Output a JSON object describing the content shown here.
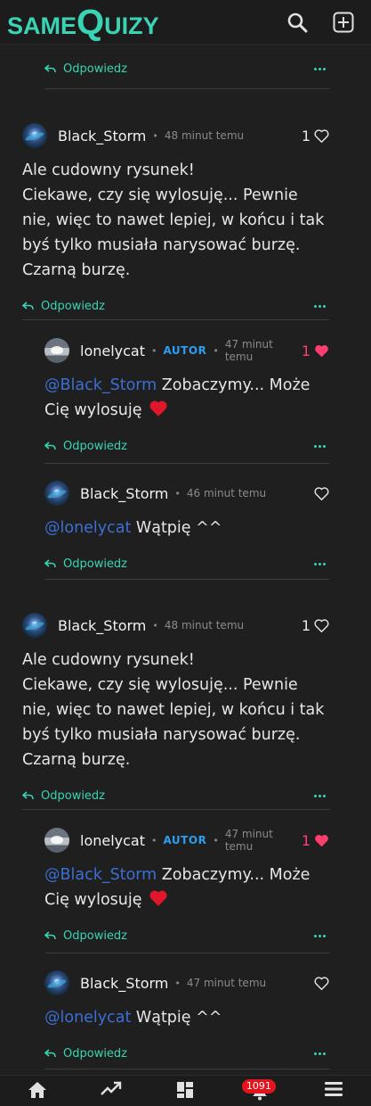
{
  "header": {
    "logo_part1": "SAME",
    "logo_part2": "Q",
    "logo_part3": "UIZY",
    "search_icon": "search-icon",
    "add_icon": "add-square-icon"
  },
  "colors": {
    "accent": "#3ad3b4",
    "mention": "#3b6fd6",
    "author_badge": "#2c9ef0",
    "liked": "#ff3d6e",
    "notif": "#e5131d"
  },
  "top_partial": {
    "reply_label": "Odpowiedz"
  },
  "threads": [
    {
      "comment": {
        "author": "Black_Storm",
        "time": "48 minut temu",
        "likes": "1",
        "text": "Ale cudowny rysunek!\nCiekawe, czy się wylosuję... Pewnie nie, więc to nawet lepiej, w końcu i tak byś tylko musiała narysować burzę. Czarną burzę.",
        "reply_label": "Odpowiedz"
      },
      "replies": [
        {
          "author": "lonelycat",
          "badge": "AUTOR",
          "time": "47 minut temu",
          "likes": "1",
          "mention": "@Black_Storm",
          "text": " Zobaczymy... Może Cię wylosuję ",
          "reply_label": "Odpowiedz"
        },
        {
          "author": "Black_Storm",
          "time": "46 minut temu",
          "likes": "",
          "mention": "@lonelycat",
          "text": " Wątpię ^^",
          "reply_label": "Odpowiedz"
        }
      ]
    },
    {
      "comment": {
        "author": "Black_Storm",
        "time": "48 minut temu",
        "likes": "1",
        "text": "Ale cudowny rysunek!\nCiekawe, czy się wylosuję... Pewnie nie, więc to nawet lepiej, w końcu i tak byś tylko musiała narysować burzę. Czarną burzę.",
        "reply_label": "Odpowiedz"
      },
      "replies": [
        {
          "author": "lonelycat",
          "badge": "AUTOR",
          "time": "47 minut temu",
          "likes": "1",
          "mention": "@Black_Storm",
          "text": " Zobaczymy... Może Cię wylosuję ",
          "reply_label": "Odpowiedz"
        },
        {
          "author": "Black_Storm",
          "time": "47 minut temu",
          "likes": "",
          "mention": "@lonelycat",
          "text": " Wątpię ^^",
          "reply_label": "Odpowiedz"
        }
      ]
    }
  ],
  "bottom_nav": {
    "items": [
      "home-icon",
      "trending-icon",
      "dashboard-icon",
      "bell-icon",
      "menu-icon"
    ],
    "notif_count": "1091"
  }
}
